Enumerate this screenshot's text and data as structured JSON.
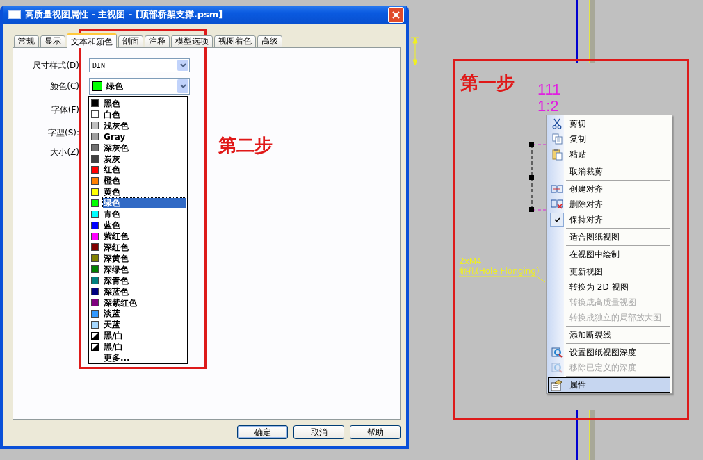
{
  "window": {
    "title": "高质量视图属性 - 主视图 - [顶部桥架支撑.psm]"
  },
  "tabs": [
    {
      "label": "常规",
      "selected": false
    },
    {
      "label": "显示",
      "selected": false
    },
    {
      "label": "文本和颜色",
      "selected": true
    },
    {
      "label": "剖面",
      "selected": false
    },
    {
      "label": "注释",
      "selected": false
    },
    {
      "label": "模型选项",
      "selected": false
    },
    {
      "label": "视图着色",
      "selected": false
    },
    {
      "label": "高级",
      "selected": false
    }
  ],
  "form": {
    "dimension_style": {
      "label": "尺寸样式(D)",
      "value": "DIN"
    },
    "color": {
      "label": "颜色(C)",
      "value": "绿色",
      "color": "#00ff00",
      "expanded": true
    },
    "other_labels": [
      "字体(F)",
      "字型(S):",
      "大小(Z)"
    ]
  },
  "color_list": [
    {
      "kind": "swatch",
      "label": "黑色",
      "color": "#000000",
      "selected": false
    },
    {
      "kind": "swatch",
      "label": "白色",
      "color": "#ffffff",
      "selected": false
    },
    {
      "kind": "swatch",
      "label": "浅灰色",
      "color": "#c0c0c0",
      "selected": false
    },
    {
      "kind": "swatch",
      "label": "Gray",
      "color": "#a0a0a0",
      "selected": false
    },
    {
      "kind": "swatch",
      "label": "深灰色",
      "color": "#707070",
      "selected": false
    },
    {
      "kind": "swatch",
      "label": "炭灰",
      "color": "#404040",
      "selected": false
    },
    {
      "kind": "swatch",
      "label": "红色",
      "color": "#ff0000",
      "selected": false
    },
    {
      "kind": "swatch",
      "label": "橙色",
      "color": "#ff8000",
      "selected": false
    },
    {
      "kind": "swatch",
      "label": "黄色",
      "color": "#ffff00",
      "selected": false
    },
    {
      "kind": "swatch",
      "label": "绿色",
      "color": "#00ff00",
      "selected": true
    },
    {
      "kind": "swatch",
      "label": "青色",
      "color": "#00ffff",
      "selected": false
    },
    {
      "kind": "swatch",
      "label": "蓝色",
      "color": "#0000ff",
      "selected": false
    },
    {
      "kind": "swatch",
      "label": "紫红色",
      "color": "#ff00ff",
      "selected": false
    },
    {
      "kind": "swatch",
      "label": "深红色",
      "color": "#800000",
      "selected": false
    },
    {
      "kind": "swatch",
      "label": "深黄色",
      "color": "#808000",
      "selected": false
    },
    {
      "kind": "swatch",
      "label": "深绿色",
      "color": "#008000",
      "selected": false
    },
    {
      "kind": "swatch",
      "label": "深青色",
      "color": "#008080",
      "selected": false
    },
    {
      "kind": "swatch",
      "label": "深蓝色",
      "color": "#000080",
      "selected": false
    },
    {
      "kind": "swatch",
      "label": "深紫红色",
      "color": "#800080",
      "selected": false
    },
    {
      "kind": "swatch",
      "label": "淡蓝",
      "color": "#3399ff",
      "selected": false
    },
    {
      "kind": "swatch",
      "label": "天蓝",
      "color": "#a6d8ff",
      "selected": false
    },
    {
      "kind": "split",
      "label": "黑/白",
      "selected": false
    },
    {
      "kind": "split",
      "label": "黑/白",
      "selected": false
    },
    {
      "kind": "more",
      "label": "更多...",
      "selected": false
    }
  ],
  "buttons": [
    {
      "label": "确定",
      "default": true
    },
    {
      "label": "取消",
      "default": false
    },
    {
      "label": "帮助",
      "default": false
    }
  ],
  "annotations": [
    "第二步",
    "第一步"
  ],
  "drawing": {
    "view_label": "111",
    "scale": "1:2",
    "callout": [
      "2xM4",
      "翻孔(Hole Flonging)"
    ]
  },
  "context_menu": [
    {
      "kind": "cut",
      "label": "剪切",
      "disabled": false,
      "checked": false,
      "selected": false
    },
    {
      "kind": "copy",
      "label": "复制",
      "disabled": false,
      "checked": false,
      "selected": false
    },
    {
      "kind": "paste",
      "label": "粘贴",
      "disabled": false,
      "checked": false,
      "selected": false
    },
    {
      "kind": "separator"
    },
    {
      "kind": "item",
      "label": "取消裁剪",
      "disabled": false,
      "checked": false,
      "selected": false
    },
    {
      "kind": "separator"
    },
    {
      "kind": "align",
      "label": "创建对齐",
      "disabled": false,
      "checked": false,
      "selected": false
    },
    {
      "kind": "unalign",
      "label": "删除对齐",
      "disabled": false,
      "checked": false,
      "selected": false
    },
    {
      "kind": "item",
      "label": "保持对齐",
      "disabled": false,
      "checked": true,
      "selected": false
    },
    {
      "kind": "separator"
    },
    {
      "kind": "item",
      "label": "适合图纸视图",
      "disabled": false,
      "checked": false,
      "selected": false
    },
    {
      "kind": "separator"
    },
    {
      "kind": "item",
      "label": "在视图中绘制",
      "disabled": false,
      "checked": false,
      "selected": false
    },
    {
      "kind": "separator"
    },
    {
      "kind": "item",
      "label": "更新视图",
      "disabled": false,
      "checked": false,
      "selected": false
    },
    {
      "kind": "item",
      "label": "转换为 2D 视图",
      "disabled": false,
      "checked": false,
      "selected": false
    },
    {
      "kind": "item",
      "label": "转换成高质量视图",
      "disabled": true,
      "checked": false,
      "selected": false
    },
    {
      "kind": "item",
      "label": "转换成独立的局部放大图",
      "disabled": true,
      "checked": false,
      "selected": false
    },
    {
      "kind": "separator"
    },
    {
      "kind": "item",
      "label": "添加断裂线",
      "disabled": false,
      "checked": false,
      "selected": false
    },
    {
      "kind": "separator"
    },
    {
      "kind": "depth",
      "label": "设置图纸视图深度",
      "disabled": false,
      "checked": false,
      "selected": false
    },
    {
      "kind": "depth",
      "label": "移除已定义的深度",
      "disabled": true,
      "checked": false,
      "selected": false
    },
    {
      "kind": "separator"
    },
    {
      "kind": "properties",
      "label": "属性",
      "disabled": false,
      "checked": false,
      "selected": true
    }
  ]
}
